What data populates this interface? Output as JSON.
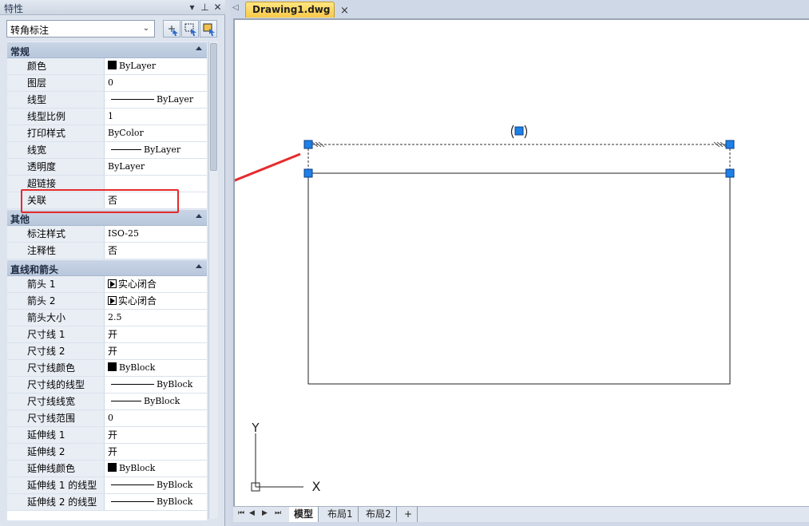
{
  "palette": {
    "title": "特性",
    "pin_icon": "pin-icon",
    "close_icon": "close-icon",
    "menu_icon": "chevron-down-icon",
    "selected_object": "转角标注",
    "categories": [
      {
        "label": "常规",
        "rows": [
          {
            "key": "颜色",
            "value": "ByLayer",
            "kind": "swatch"
          },
          {
            "key": "图层",
            "value": "0",
            "kind": "text"
          },
          {
            "key": "线型",
            "value": "ByLayer",
            "kind": "line-long"
          },
          {
            "key": "线型比例",
            "value": "1",
            "kind": "text"
          },
          {
            "key": "打印样式",
            "value": "ByColor",
            "kind": "text"
          },
          {
            "key": "线宽",
            "value": "ByLayer",
            "kind": "line-short"
          },
          {
            "key": "透明度",
            "value": "ByLayer",
            "kind": "text"
          },
          {
            "key": "超链接",
            "value": "",
            "kind": "text"
          },
          {
            "key": "关联",
            "value": "否",
            "kind": "cjk"
          }
        ]
      },
      {
        "label": "其他",
        "rows": [
          {
            "key": "标注样式",
            "value": "ISO-25",
            "kind": "text"
          },
          {
            "key": "注释性",
            "value": "否",
            "kind": "cjk"
          }
        ]
      },
      {
        "label": "直线和箭头",
        "rows": [
          {
            "key": "箭头 1",
            "value": "实心闭合",
            "kind": "arrowhead"
          },
          {
            "key": "箭头 2",
            "value": "实心闭合",
            "kind": "arrowhead"
          },
          {
            "key": "箭头大小",
            "value": "2.5",
            "kind": "text"
          },
          {
            "key": "尺寸线 1",
            "value": "开",
            "kind": "cjk"
          },
          {
            "key": "尺寸线 2",
            "value": "开",
            "kind": "cjk"
          },
          {
            "key": "尺寸线颜色",
            "value": "ByBlock",
            "kind": "swatch"
          },
          {
            "key": "尺寸线的线型",
            "value": "ByBlock",
            "kind": "line-long"
          },
          {
            "key": "尺寸线线宽",
            "value": "ByBlock",
            "kind": "line-short"
          },
          {
            "key": "尺寸线范围",
            "value": "0",
            "kind": "text"
          },
          {
            "key": "延伸线 1",
            "value": "开",
            "kind": "cjk"
          },
          {
            "key": "延伸线 2",
            "value": "开",
            "kind": "cjk"
          },
          {
            "key": "延伸线颜色",
            "value": "ByBlock",
            "kind": "swatch"
          },
          {
            "key": "延伸线 1 的线型",
            "value": "ByBlock",
            "kind": "line-long"
          },
          {
            "key": "延伸线 2 的线型",
            "value": "ByBlock",
            "kind": "line-long"
          }
        ]
      }
    ],
    "highlighted_property": "关联"
  },
  "document": {
    "tab_name": "Drawing1.dwg",
    "close_symbol": "×",
    "nav_left_symbol": "◁",
    "axis_y_label": "Y",
    "axis_x_label": "X",
    "colors": {
      "grip": "#1e7fe6",
      "annotation_arrow": "#e52b2b",
      "highlight": "#e52b2b",
      "tab_active": "#f8c94a"
    }
  },
  "layouts": {
    "nav_buttons": [
      "⏮",
      "◀",
      "▶",
      "⏭"
    ],
    "tabs": [
      {
        "label": "模型",
        "active": true
      },
      {
        "label": "布局1",
        "active": false
      },
      {
        "label": "布局2",
        "active": false
      },
      {
        "label": "+",
        "active": false
      }
    ]
  }
}
